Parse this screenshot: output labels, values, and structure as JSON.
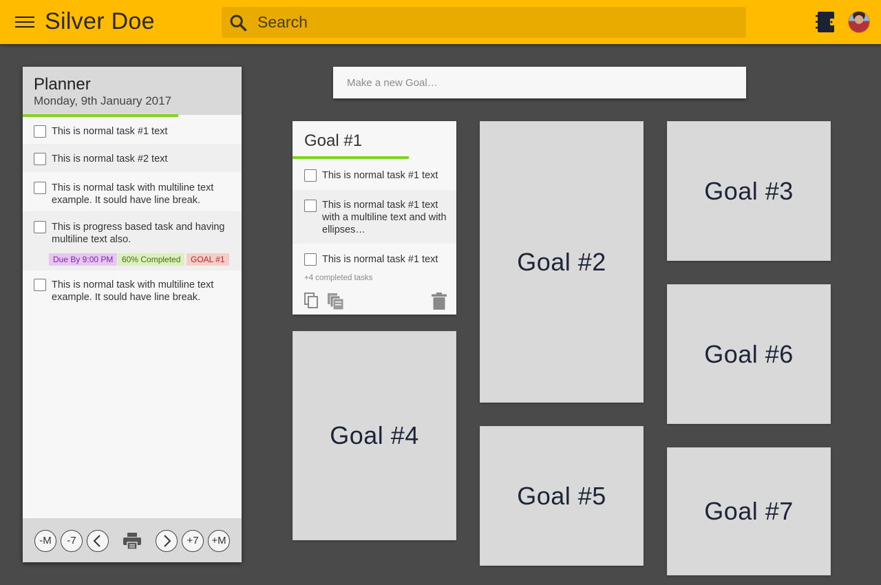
{
  "header": {
    "app_title": "Silver Doe",
    "search_placeholder": "Search"
  },
  "planner": {
    "title": "Planner",
    "date": "Monday, 9th January 2017",
    "progress": 0.71,
    "tasks": [
      {
        "text": "This is normal task #1 text"
      },
      {
        "text": "This is normal task #2 text"
      },
      {
        "text": "This is normal task with multiline text example. It sould have line break."
      },
      {
        "text": "This is progress based task and having multiline text also.",
        "tags": {
          "due": "Due By 9:00 PM",
          "progress": "60% Completed",
          "goal": "GOAL #1"
        }
      },
      {
        "text": "This is normal task with multiline text example. It sould have line break."
      }
    ],
    "footer": {
      "minus_month": "-M",
      "minus_week": "-7",
      "plus_week": "+7",
      "plus_month": "+M"
    }
  },
  "new_goal": {
    "placeholder": "Make a new Goal…"
  },
  "goal1": {
    "title": "Goal #1",
    "progress": 0.71,
    "tasks": [
      {
        "text": "This is normal task #1 text"
      },
      {
        "text": "This is normal task #1 text with a multiline text and with ellipses…"
      },
      {
        "text": "This is normal task #1 text"
      }
    ],
    "completed_note": "+4 completed tasks"
  },
  "goals": {
    "g2": "Goal #2",
    "g3": "Goal #3",
    "g4": "Goal #4",
    "g5": "Goal #5",
    "g6": "Goal #6",
    "g7": "Goal #7"
  },
  "colors": {
    "accent": "#ffbb00",
    "progress": "#7ed321",
    "background": "#4a4a4a"
  },
  "icons": [
    "menu-icon",
    "search-icon",
    "notebook-icon",
    "avatar",
    "chevron-left-icon",
    "print-icon",
    "chevron-right-icon",
    "copy-icon",
    "copy-stack-icon",
    "trash-icon"
  ]
}
